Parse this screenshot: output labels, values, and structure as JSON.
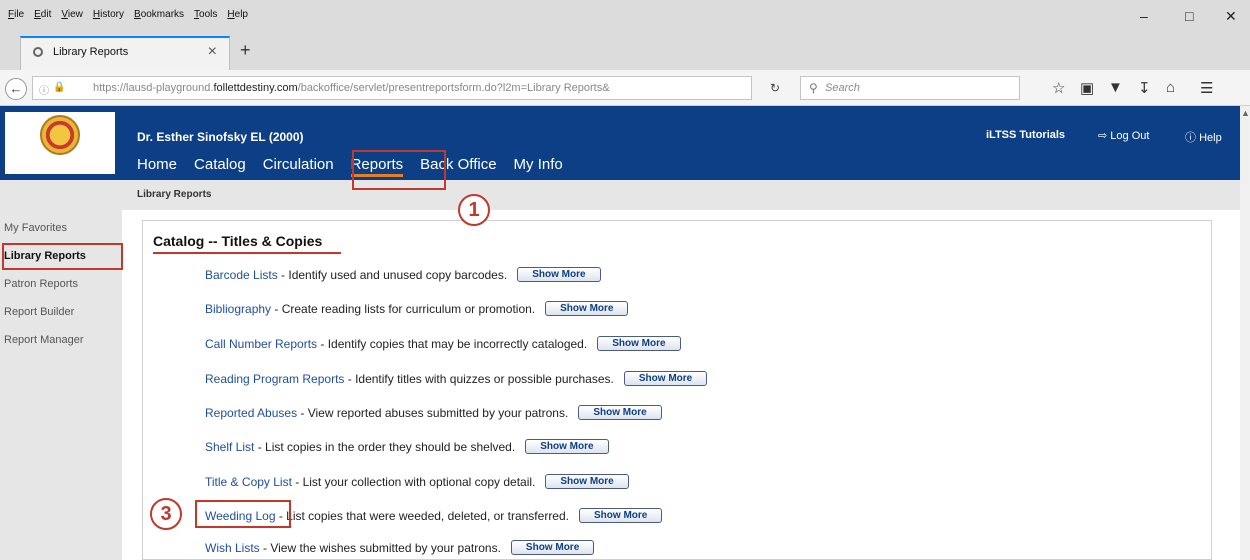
{
  "browser": {
    "menu": [
      "File",
      "Edit",
      "View",
      "History",
      "Bookmarks",
      "Tools",
      "Help"
    ],
    "window_controls": {
      "minimize": "–",
      "maximize": "□",
      "close": "✕"
    },
    "tab": {
      "title": "Library Reports",
      "close": "×"
    },
    "new_tab": "+",
    "url_prefix": "https://lausd-playground.",
    "url_domain": "follettdestiny.com",
    "url_rest": "/backoffice/servlet/presentreportsform.do?l2m=Library Reports&",
    "search_placeholder": "Search",
    "icons": [
      "star-icon",
      "clipboard-icon",
      "pocket-icon",
      "download-icon",
      "home-icon",
      "hamburger-menu-icon"
    ]
  },
  "header": {
    "school": "Dr. Esther Sinofsky EL (2000)",
    "nav": [
      "Home",
      "Catalog",
      "Circulation",
      "Reports",
      "Back Office",
      "My Info"
    ],
    "tutorials": "iLTSS Tutorials",
    "logout": "Log Out",
    "help": "Help"
  },
  "subheader": "Library Reports",
  "sidebar": [
    "My Favorites",
    "Library Reports",
    "Patron Reports",
    "Report Builder",
    "Report Manager"
  ],
  "section": {
    "title": "Catalog -- Titles & Copies",
    "show_more": "Show More",
    "reports": [
      {
        "name": "Barcode Lists",
        "desc": " - Identify used and unused copy barcodes."
      },
      {
        "name": "Bibliography",
        "desc": " - Create reading lists for curriculum or promotion."
      },
      {
        "name": "Call Number Reports",
        "desc": " - Identify copies that may be incorrectly cataloged."
      },
      {
        "name": "Reading Program Reports",
        "desc": " - Identify titles with quizzes or possible purchases."
      },
      {
        "name": "Reported Abuses",
        "desc": " - View reported abuses submitted by your patrons."
      },
      {
        "name": "Shelf List",
        "desc": " - List copies in the order they should be shelved."
      },
      {
        "name": "Title & Copy List",
        "desc": " - List your collection with optional copy detail."
      },
      {
        "name": "Weeding Log",
        "desc": " - List copies that were weeded, deleted, or transferred."
      },
      {
        "name": "Wish Lists",
        "desc": " - View the wishes submitted by your patrons."
      }
    ]
  },
  "annotations": {
    "step1": "1",
    "step3": "3"
  },
  "colors": {
    "header_bg": "#0d3f86",
    "annotation": "#c0392b",
    "nav_underline": "#e67e22"
  }
}
